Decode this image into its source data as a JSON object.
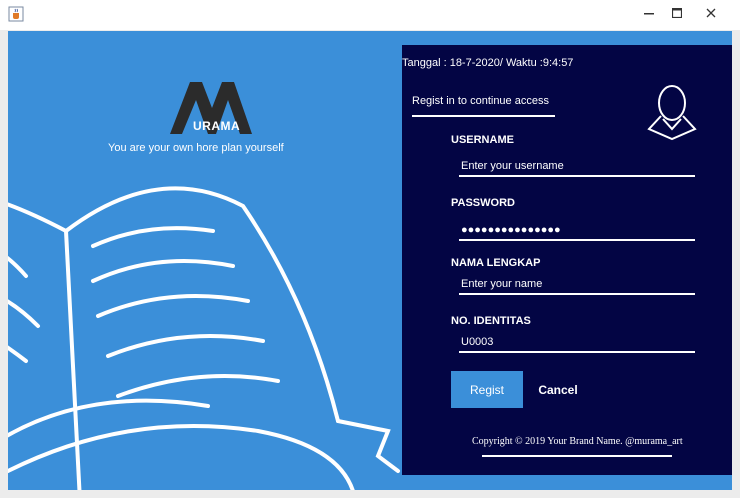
{
  "window": {
    "minimize_icon": "minimize-icon",
    "maximize_icon": "maximize-icon",
    "close_icon": "close-icon",
    "app_icon": "java-cup-icon"
  },
  "brand": {
    "logo_text": "URAMA",
    "tagline": "You are your own hore plan yourself"
  },
  "form": {
    "datetime": "Tanggal : 18-7-2020/  Waktu :9:4:57",
    "subtitle": "Regist in to continue access",
    "avatar_icon": "user-avatar-icon",
    "username_label": "USERNAME",
    "username_placeholder": "Enter your username",
    "password_label": "PASSWORD",
    "password_value": "●●●●●●●●●●●●●●●",
    "fullname_label": "NAMA LENGKAP",
    "fullname_placeholder": "Enter your name",
    "id_label": "NO. IDENTITAS",
    "id_value": "U0003",
    "regist_button": "Regist",
    "cancel_button": "Cancel",
    "copyright": "Copyright © 2019 Your Brand Name. @murama_art"
  },
  "colors": {
    "background_blue": "#3b8fd9",
    "panel_navy": "#030544",
    "text_white": "#ffffff"
  }
}
